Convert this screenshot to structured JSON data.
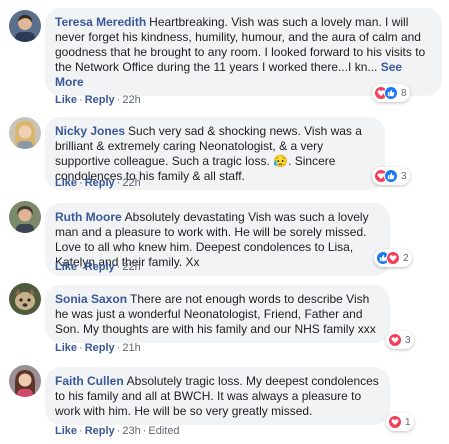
{
  "actions": {
    "like": "Like",
    "reply": "Reply",
    "dot": "·",
    "edited": "Edited"
  },
  "comments": [
    {
      "author": "Teresa Meredith",
      "text": "Heartbreaking. Vish was such a lovely man. I will never forget his kindness, humility, humour, and the aura of calm and goodness that he brought to any room. I looked forward to his visits to the Network Office during the 11 years I worked there...I kn...",
      "see_more": "See More",
      "time": "22h",
      "reaction_count": "8"
    },
    {
      "author": "Nicky Jones",
      "text": "Such very sad & shocking news. Vish was a brilliant & extremely caring Neonatologist, & a very supportive colleague. Such a tragic loss. 😥. Sincere condolences to his family & all staff.",
      "time": "22h",
      "reaction_count": "3"
    },
    {
      "author": "Ruth Moore",
      "text": "Absolutely devastating Vish was such a lovely man and a pleasure to work with. He will be sorely missed. Love to all who knew him. Deepest condolences to Lisa, Katelyn and their family. Xx",
      "time": "22h",
      "reaction_count": "2"
    },
    {
      "author": "Sonia Saxon",
      "text": "There are not enough words to describe Vish he was just a wonderful Neonatologist, Friend, Father and Son. My thoughts are with his family and our NHS family xxx",
      "time": "21h",
      "reaction_count": "3"
    },
    {
      "author": "Faith Cullen",
      "text": "Absolutely tragic loss. My deepest condolences to his family and all at BWCH. It was always a pleasure to work with him. He will be so very greatly missed.",
      "time": "23h",
      "reaction_count": "1"
    }
  ],
  "colors": {
    "link": "#385898",
    "bubble": "#f2f3f5",
    "love": "#f33e58",
    "like": "#1877f2"
  },
  "icons": [
    "love-reaction-icon",
    "like-reaction-icon"
  ]
}
